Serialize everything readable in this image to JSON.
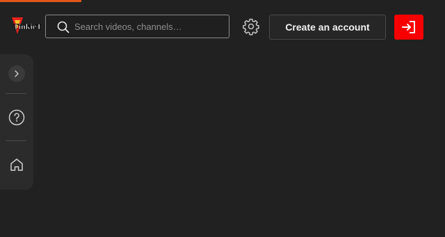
{
  "brand": {
    "name": "TinkieTube",
    "logo_icon": "tinkietube-logo-icon",
    "colors": {
      "progress": "#e0571a",
      "login_button": "#f80000",
      "background": "#212121"
    }
  },
  "header": {
    "search": {
      "placeholder": "Search videos, channels…",
      "value": "",
      "icon": "search-icon"
    },
    "settings": {
      "icon": "gear-icon"
    },
    "create_account_label": "Create an account",
    "login": {
      "icon": "login-icon"
    }
  },
  "sidebar": {
    "items": [
      {
        "name": "expand",
        "icon": "chevron-right-icon"
      },
      {
        "name": "help",
        "icon": "help-circle-icon"
      },
      {
        "name": "home",
        "icon": "home-icon"
      }
    ]
  }
}
